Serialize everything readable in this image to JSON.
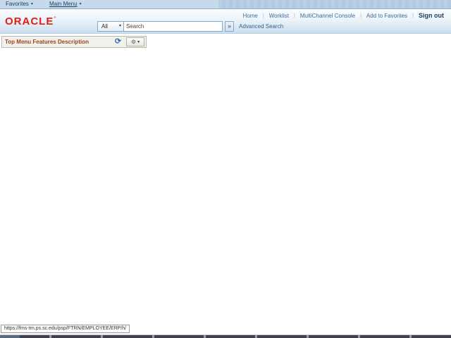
{
  "top_bar": {
    "favorites_label": "Favorites",
    "main_menu_label": "Main Menu"
  },
  "header": {
    "logo": "ORACLE",
    "registered_mark": "®",
    "links": [
      "Home",
      "Worklist",
      "MultiChannel Console",
      "Add to Favorites"
    ],
    "link_separator": "|",
    "sign_out_label": "Sign out",
    "search": {
      "scope_value": "All",
      "placeholder": "Search",
      "go_label": "»",
      "advanced_label": "Advanced Search"
    }
  },
  "pagelet": {
    "title": "Top Menu Features Description"
  },
  "status_bar": {
    "url": "https://fms-trn.ps.sc.edu/psp/FTRN/EMPLOYEE/ERP/h/"
  },
  "icons": {
    "chevron_down": "▾",
    "refresh": "⟳",
    "gear": "⚙"
  },
  "colors": {
    "topbar_bg": "#c6daeb",
    "header_gradient_bottom": "#cadeef",
    "oracle_red": "#e21e0e",
    "link_blue": "#3a6b9e",
    "signout_navy": "#1d3d63",
    "pagelet_title_maroon": "#9c421d",
    "pagelet_bg": "#f2f1ec"
  }
}
